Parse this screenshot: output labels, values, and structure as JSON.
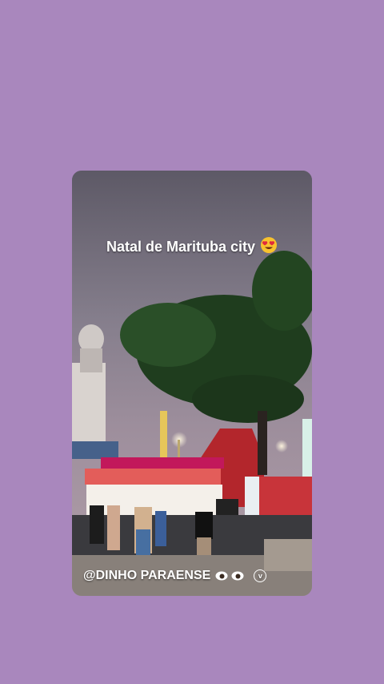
{
  "story": {
    "caption": "Natal de Marituba city",
    "caption_emoji": "heart-eyes-emoji",
    "handle": "@DINHO PARAENSE",
    "handle_icons": [
      "eyes-icon",
      "verified-badge-icon"
    ],
    "verified_glyph": "v"
  },
  "colors": {
    "page_background": "#a987bd",
    "sky": "#6f6b78",
    "tree": "#1f3d1e",
    "stall_roof": "#c2185b"
  }
}
